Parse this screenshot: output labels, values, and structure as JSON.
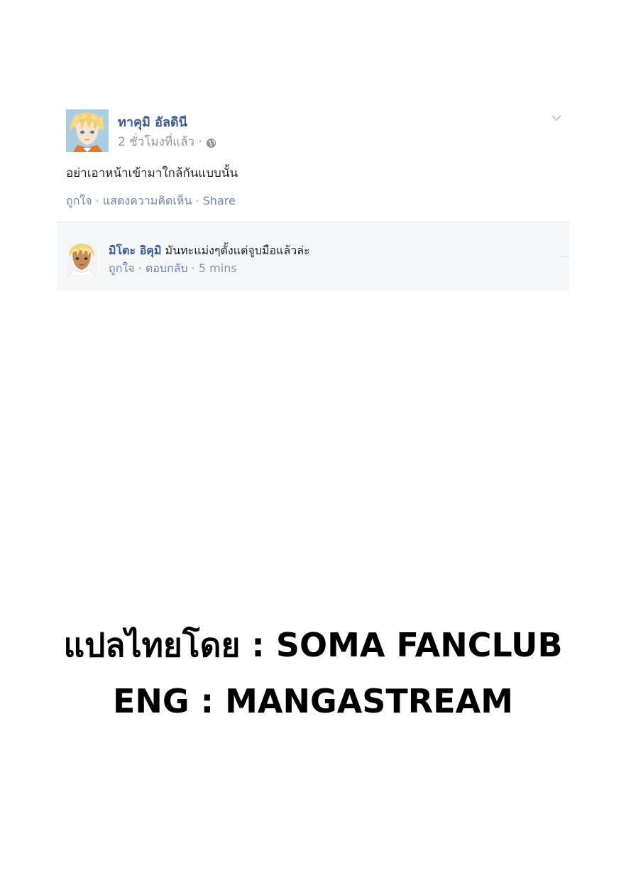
{
  "post": {
    "author": "ทาคุมิ อัลดินี",
    "time": "2 ชั่วโมงที่แล้ว ·",
    "body": "อย่าเอาหน้าเข้ามาใกล้กันแบบนั้น",
    "actions": {
      "like": "ถูกใจ",
      "comment": "แสดงความคิดเห็น",
      "share": "Share",
      "separator": " · "
    }
  },
  "comment": {
    "author": "มิโตะ อิคุมิ",
    "text": " มันทะแม่งๆตั้งแต่จูบมือแล้วล่ะ",
    "actions": {
      "like": "ถูกใจ",
      "reply": "ตอบกลับ",
      "time": "5 mins",
      "separator": " · "
    }
  },
  "credits": {
    "translator": "แปลไทยโดย : SOMA FANCLUB",
    "english": "ENG : MANGASTREAM"
  },
  "colors": {
    "link": "#3b5998",
    "action": "#6d84b4",
    "meta": "#90949c",
    "comment_bg": "#f6f7f9"
  },
  "icons": [
    "globe-icon",
    "chevron-down-icon"
  ]
}
